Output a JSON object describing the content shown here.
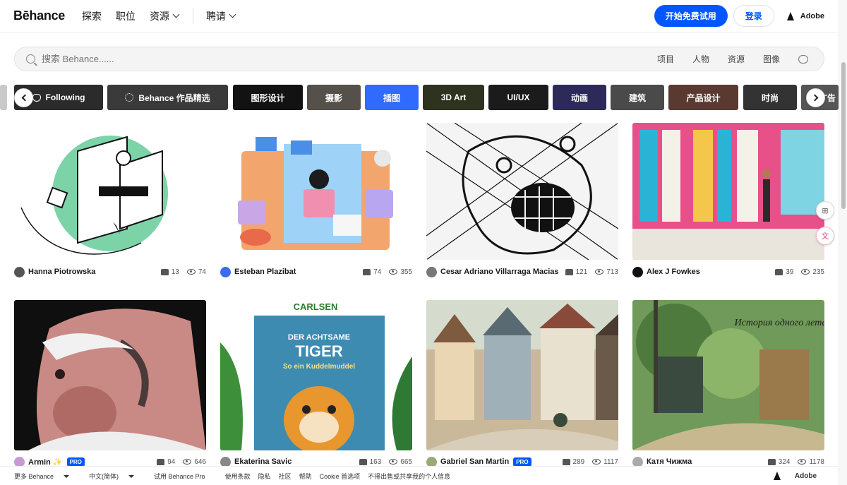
{
  "header": {
    "logo": "Bēhance",
    "nav": [
      {
        "label": "探索"
      },
      {
        "label": "职位"
      },
      {
        "label": "资源"
      },
      {
        "label": "聘请"
      }
    ],
    "trial_button": "开始免费试用",
    "login_button": "登录",
    "adobe": "Adobe"
  },
  "search": {
    "placeholder": "搜索 Behance......",
    "filters": [
      "项目",
      "人物",
      "资源",
      "图像"
    ]
  },
  "categories": [
    {
      "label": "Following",
      "color": "#2b2b2b"
    },
    {
      "label": "Behance 作品精选",
      "color": "#3a3a3a"
    },
    {
      "label": "图形设计",
      "color": "#121212"
    },
    {
      "label": "摄影",
      "color": "#55504a"
    },
    {
      "label": "插图",
      "color": "#2f6bff"
    },
    {
      "label": "3D Art",
      "color": "#2e3320"
    },
    {
      "label": "UI/UX",
      "color": "#1b1b1b"
    },
    {
      "label": "动画",
      "color": "#2d2a5a"
    },
    {
      "label": "建筑",
      "color": "#4a4a4a"
    },
    {
      "label": "产品设计",
      "color": "#5a3a30"
    },
    {
      "label": "时尚",
      "color": "#333333"
    },
    {
      "label": "广告",
      "color": "#555555"
    }
  ],
  "projects": [
    {
      "author": "Hanna Piotrowska",
      "likes": "13",
      "views": "74",
      "pro": false,
      "bg": "#ffffff",
      "accent": "#7dd3a8",
      "avatar": "#555"
    },
    {
      "author": "Esteban Plazibat",
      "likes": "74",
      "views": "355",
      "pro": false,
      "bg": "#0d0d0d",
      "accent": "#ef8a5a",
      "avatar": "#3b6cf0"
    },
    {
      "author": "Cesar Adriano Villarraga Macias",
      "likes": "121",
      "views": "713",
      "pro": false,
      "bg": "#f2f2f2",
      "accent": "#222222",
      "avatar": "#777"
    },
    {
      "author": "Alex J Fowkes",
      "likes": "39",
      "views": "235",
      "pro": false,
      "bg": "#e8508a",
      "accent": "#2bb3d6",
      "avatar": "#111"
    },
    {
      "author": "Armin ✨",
      "likes": "94",
      "views": "646",
      "pro": true,
      "bg": "#0f0f0f",
      "accent": "#c98a86",
      "avatar": "#c79ad6"
    },
    {
      "author": "Ekaterina Savic",
      "likes": "163",
      "views": "665",
      "pro": false,
      "bg": "#3e8f3a",
      "accent": "#e8962e",
      "avatar": "#888"
    },
    {
      "author": "Gabriel San Martin",
      "likes": "289",
      "views": "1117",
      "pro": true,
      "bg": "#c9b99a",
      "accent": "#7e5a3e",
      "avatar": "#9a7"
    },
    {
      "author": "Катя Чижма",
      "likes": "324",
      "views": "1178",
      "pro": false,
      "bg": "#6f9a5a",
      "accent": "#c8b890",
      "avatar": "#aaa"
    }
  ],
  "card_texts": {
    "carlsen": "CARLSEN",
    "book_title": "DER ACHTSAME",
    "book_tiger": "TIGER",
    "book_sub": "So ein Kuddelmuddel",
    "russian": "История одного лета"
  },
  "pro_label": "PRO",
  "footer": {
    "more": "更多 Behance",
    "language": "中文(简体)",
    "try_pro": "试用 Behance Pro",
    "links": [
      "使用条款",
      "隐私",
      "社区",
      "帮助",
      "Cookie 首选项",
      "不得出售或共享我的个人信息"
    ],
    "adobe": "Adobe"
  }
}
